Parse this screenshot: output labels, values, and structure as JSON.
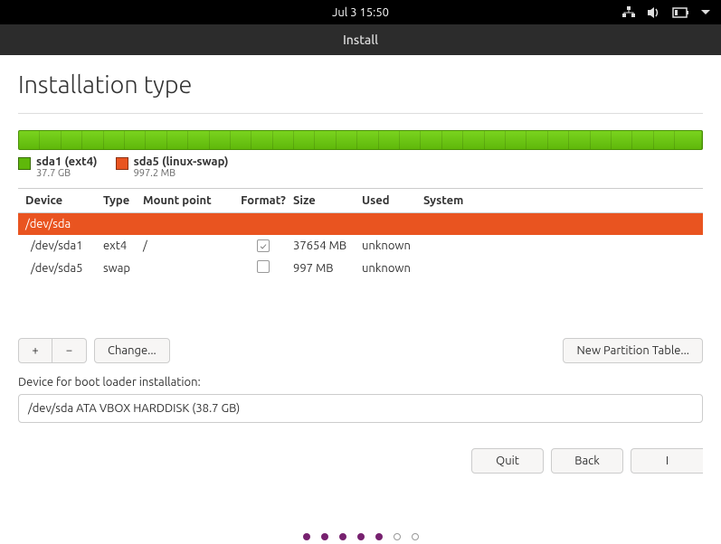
{
  "topbar": {
    "datetime": "Jul 3  15:50"
  },
  "window": {
    "title": "Install"
  },
  "page": {
    "title": "Installation type"
  },
  "legend": [
    {
      "name": "sda1 (ext4)",
      "size": "37.7 GB",
      "color": "#5fb80a"
    },
    {
      "name": "sda5 (linux-swap)",
      "size": "997.2 MB",
      "color": "#e95420"
    }
  ],
  "table": {
    "headers": {
      "device": "Device",
      "type": "Type",
      "mount": "Mount point",
      "format": "Format?",
      "size": "Size",
      "used": "Used",
      "system": "System"
    },
    "rows": [
      {
        "device": "/dev/sda",
        "type": "",
        "mount": "",
        "format": null,
        "size": "",
        "used": "",
        "system": "",
        "selected": true
      },
      {
        "device": "/dev/sda1",
        "type": "ext4",
        "mount": "/",
        "format": true,
        "size": "37654 MB",
        "used": "unknown",
        "system": ""
      },
      {
        "device": "/dev/sda5",
        "type": "swap",
        "mount": "",
        "format": false,
        "size": "997 MB",
        "used": "unknown",
        "system": ""
      }
    ]
  },
  "toolbar": {
    "add": "+",
    "remove": "−",
    "change": "Change...",
    "new_table": "New Partition Table..."
  },
  "bootloader": {
    "label": "Device for boot loader installation:",
    "value": "/dev/sda   ATA VBOX HARDDISK (38.7 GB)"
  },
  "nav": {
    "quit": "Quit",
    "back": "Back",
    "install": "I"
  }
}
